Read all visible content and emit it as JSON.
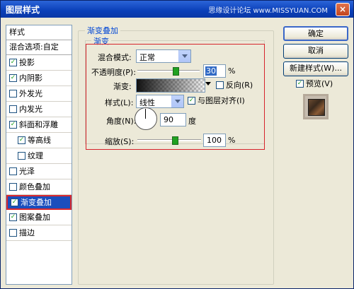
{
  "window": {
    "title": "图层样式",
    "watermark": "思缘设计论坛 www.MISSYUAN.COM",
    "close": "×"
  },
  "styles_panel": {
    "header": "样式",
    "blend_options": "混合选项:自定",
    "items": [
      {
        "label": "投影",
        "checked": true
      },
      {
        "label": "内阴影",
        "checked": true
      },
      {
        "label": "外发光",
        "checked": false
      },
      {
        "label": "内发光",
        "checked": false
      },
      {
        "label": "斜面和浮雕",
        "checked": true
      },
      {
        "label": "等高线",
        "checked": true
      },
      {
        "label": "纹理",
        "checked": false
      },
      {
        "label": "光泽",
        "checked": false
      },
      {
        "label": "颜色叠加",
        "checked": false
      },
      {
        "label": "渐变叠加",
        "checked": true
      },
      {
        "label": "图案叠加",
        "checked": true
      },
      {
        "label": "描边",
        "checked": false
      }
    ]
  },
  "gradient_overlay": {
    "group_title": "渐变叠加",
    "subgroup_title": "渐变",
    "blend_mode_label": "混合模式:",
    "blend_mode_value": "正常",
    "opacity_label": "不透明度(P):",
    "opacity_value": "30",
    "opacity_unit": "%",
    "opacity_level": 0.3,
    "gradient_label": "渐变:",
    "reverse_label": "反向(R)",
    "reverse_checked": false,
    "style_label": "样式(L):",
    "style_value": "线性",
    "align_label": "与图层对齐(I)",
    "align_checked": true,
    "angle_label": "角度(N):",
    "angle_value": "90",
    "angle_unit": "度",
    "scale_label": "缩放(S):",
    "scale_value": "100",
    "scale_unit": "%",
    "scale_level": 1.0
  },
  "buttons": {
    "ok": "确定",
    "cancel": "取消",
    "new_style": "新建样式(W)...",
    "preview": "预览(V)",
    "preview_checked": true
  },
  "colors": {
    "selection": "#1a4ebd",
    "accent_red": "#d6232b",
    "check_green": "#21a121"
  }
}
